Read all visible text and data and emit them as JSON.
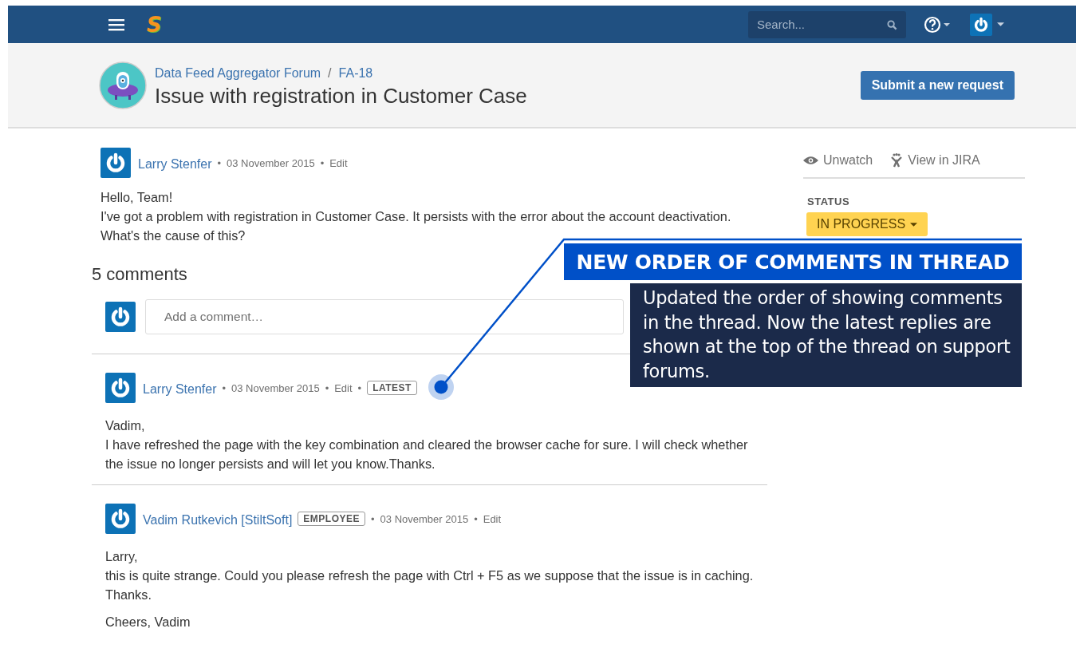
{
  "nav": {
    "logo": "S",
    "search": {
      "placeholder": "Search..."
    }
  },
  "header": {
    "breadcrumbs": [
      "Data Feed Aggregator Forum",
      "FA-18"
    ],
    "breadcrumb_separator": "/",
    "title": "Issue with registration in Customer Case",
    "button": "Submit a new request"
  },
  "meta_separator": "•",
  "issue": {
    "author": "Larry Stenfer",
    "date": "03 November 2015",
    "action": "Edit",
    "paragraphs": [
      [
        "Hello, Team!",
        "I've got a problem with registration in Customer Case. It persists with the error about the account deactivation.",
        "What's the cause of this?"
      ]
    ]
  },
  "comments_heading": "5 comments",
  "comment_input": {
    "placeholder": "Add a comment…"
  },
  "comments": [
    {
      "author": "Larry Stenfer",
      "badge": {
        "kind": "latest",
        "text": "LATEST"
      },
      "date": "03 November 2015",
      "action": "Edit",
      "paragraphs": [
        [
          "Vadim,",
          "I have refreshed the page with the key combination and cleared the browser cache for sure. I will check whether the issue no longer persists and will let you know.Thanks."
        ]
      ]
    },
    {
      "author": "Vadim Rutkevich [StiltSoft]",
      "badge": {
        "kind": "employee",
        "text": "EMPLOYEE"
      },
      "date": "03 November 2015",
      "action": "Edit",
      "paragraphs": [
        [
          "Larry,",
          "this is quite strange. Could you please refresh the page with Ctrl + F5 as we suppose that the issue is in caching.",
          "Thanks."
        ],
        [
          "Cheers, Vadim"
        ]
      ]
    }
  ],
  "sidebar": {
    "actions": [
      {
        "kind": "eye",
        "label": "Unwatch"
      },
      {
        "kind": "jira",
        "label": "View in JIRA"
      }
    ],
    "status_label": "STATUS",
    "status": "IN PROGRESS"
  },
  "annotation": {
    "title": "NEW ORDER OF COMMENTS IN THREAD",
    "text": "Updated the order of showing comments in the thread. Now the latest replies are shown at the top of the thread on support forums."
  }
}
